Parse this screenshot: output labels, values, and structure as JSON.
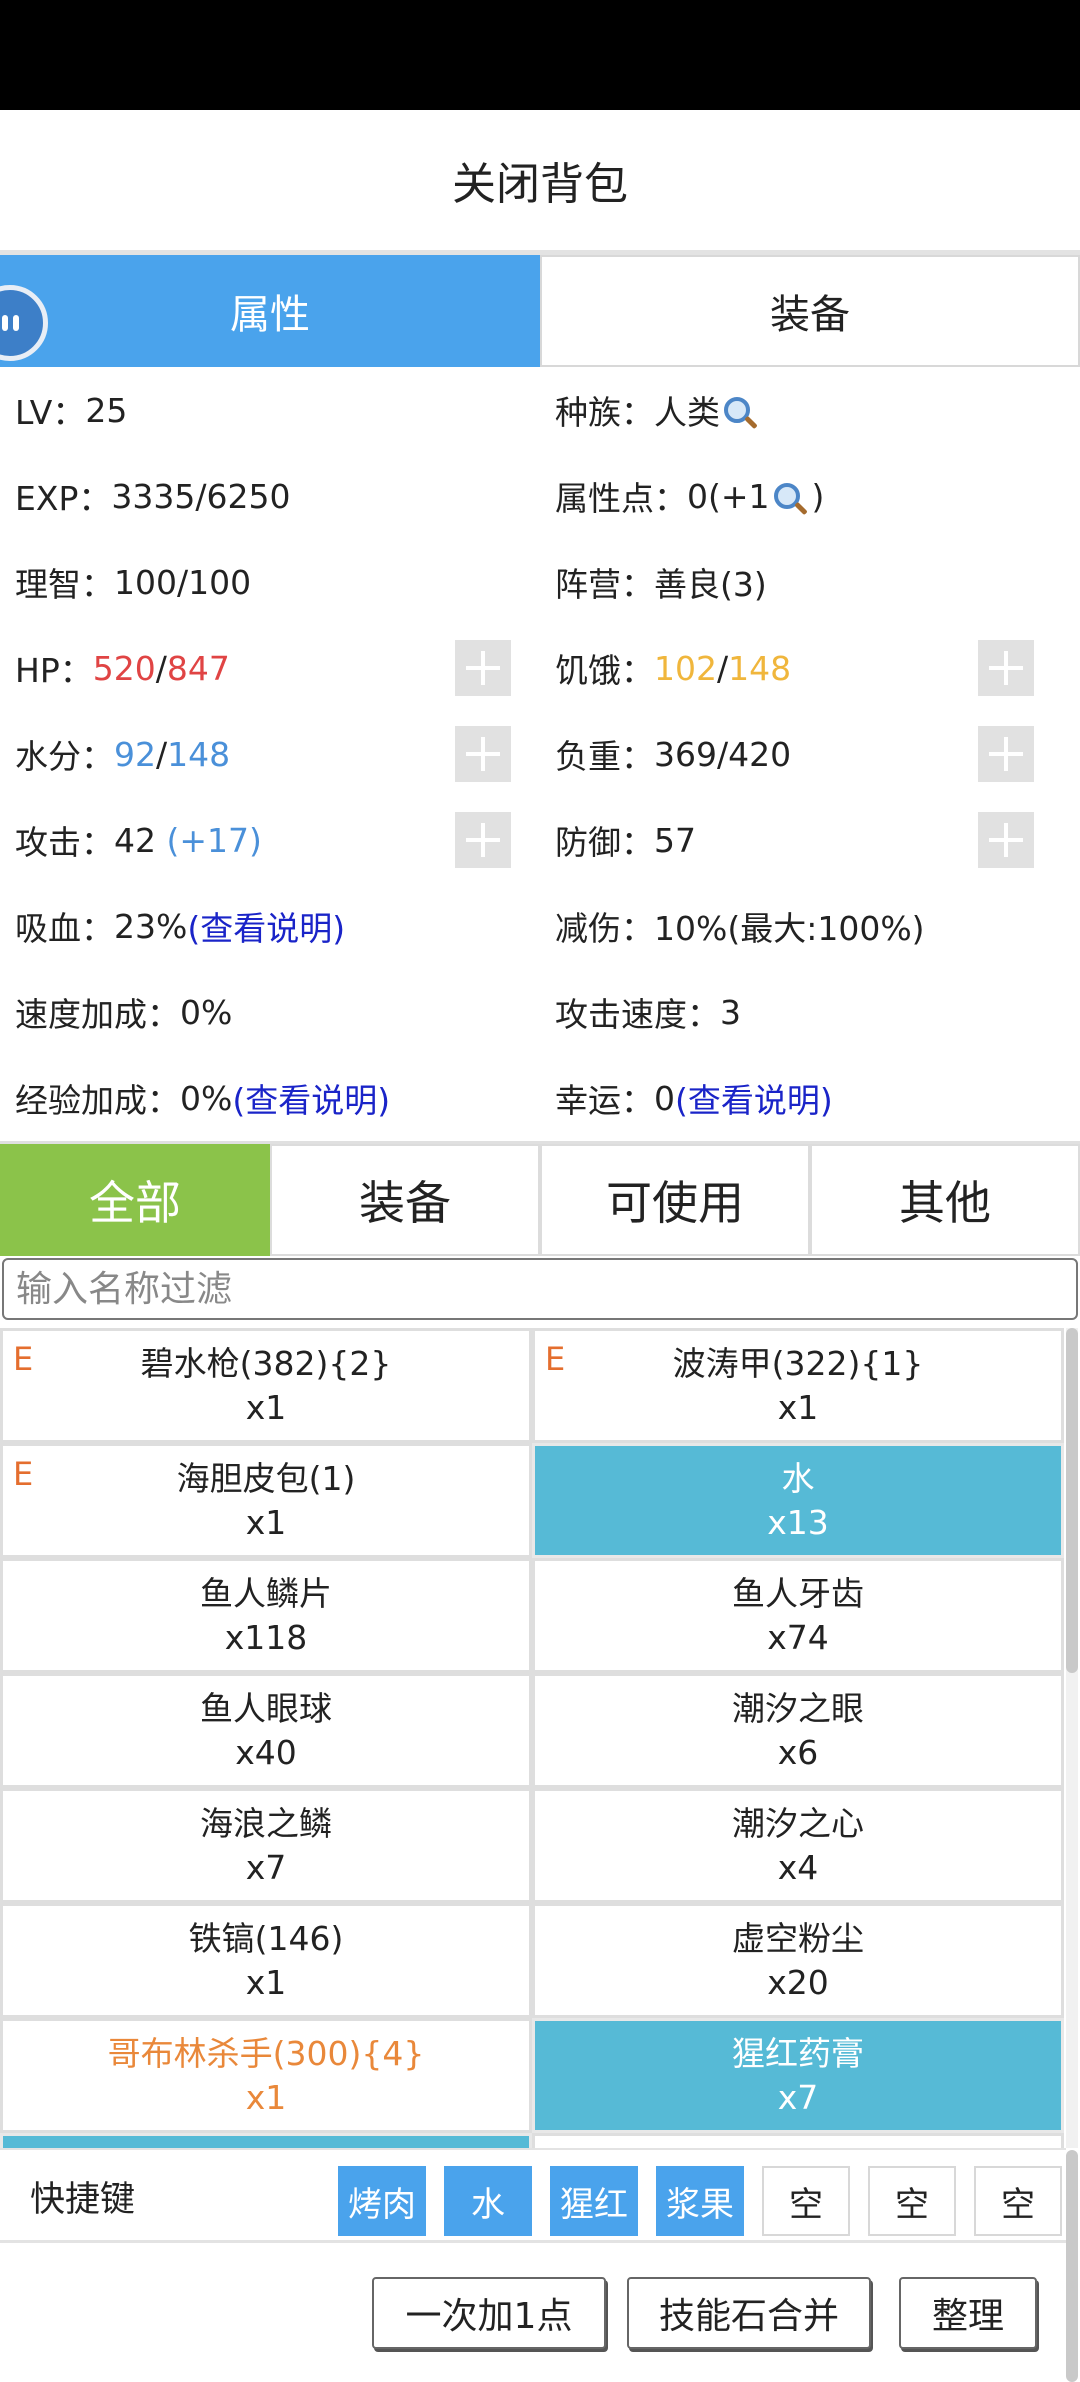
{
  "header": {
    "title": "关闭背包"
  },
  "top_tabs": [
    {
      "label": "属性",
      "active": true
    },
    {
      "label": "装备",
      "active": false
    }
  ],
  "stats": {
    "lv_label": "LV：",
    "lv_value": "25",
    "race_label": "种族：",
    "race_value": "人类",
    "exp_label": "EXP：",
    "exp_value": "3335/6250",
    "points_label": "属性点：",
    "points_value": "0(+1",
    "points_close": ")",
    "sanity_label": "理智：",
    "sanity_value": "100/100",
    "camp_label": "阵营：",
    "camp_value": "善良(3)",
    "hp_label": "HP：",
    "hp_current": "520",
    "hp_sep": "/",
    "hp_max": "847",
    "hunger_label": "饥饿：",
    "hunger_current": "102",
    "hunger_sep": "/",
    "hunger_max": "148",
    "water_label": "水分：",
    "water_current": "92",
    "water_sep": "/",
    "water_max": "148",
    "load_label": "负重：",
    "load_value": "369/420",
    "attack_label": "攻击：",
    "attack_value": "42 ",
    "attack_bonus": "(+17)",
    "defense_label": "防御：",
    "defense_value": "57",
    "lifesteal_label": "吸血：",
    "lifesteal_value": "23%",
    "lifesteal_link": "(查看说明)",
    "dmgreduce_label": "减伤：",
    "dmgreduce_value": "10%(最大:100%)",
    "speed_label": "速度加成：",
    "speed_value": "0%",
    "atkspeed_label": "攻击速度：",
    "atkspeed_value": "3",
    "expbonus_label": "经验加成：",
    "expbonus_value": "0%",
    "expbonus_link": "(查看说明)",
    "luck_label": "幸运：",
    "luck_value": "0",
    "luck_link": "(查看说明)"
  },
  "category_tabs": [
    {
      "label": "全部",
      "active": true
    },
    {
      "label": "装备",
      "active": false
    },
    {
      "label": "可使用",
      "active": false
    },
    {
      "label": "其他",
      "active": false
    }
  ],
  "filter": {
    "placeholder": "输入名称过滤"
  },
  "items": [
    {
      "mark": "E",
      "name": "碧水枪(382){2}",
      "qty": "x1",
      "style": "normal"
    },
    {
      "mark": "E",
      "name": "波涛甲(322){1}",
      "qty": "x1",
      "style": "normal"
    },
    {
      "mark": "E",
      "name": "海胆皮包(1)",
      "qty": "x1",
      "style": "normal"
    },
    {
      "mark": "",
      "name": "水",
      "qty": "x13",
      "style": "teal"
    },
    {
      "mark": "",
      "name": "鱼人鳞片",
      "qty": "x118",
      "style": "normal"
    },
    {
      "mark": "",
      "name": "鱼人牙齿",
      "qty": "x74",
      "style": "normal"
    },
    {
      "mark": "",
      "name": "鱼人眼球",
      "qty": "x40",
      "style": "normal"
    },
    {
      "mark": "",
      "name": "潮汐之眼",
      "qty": "x6",
      "style": "normal"
    },
    {
      "mark": "",
      "name": "海浪之鳞",
      "qty": "x7",
      "style": "normal"
    },
    {
      "mark": "",
      "name": "潮汐之心",
      "qty": "x4",
      "style": "normal"
    },
    {
      "mark": "",
      "name": "铁镐(146)",
      "qty": "x1",
      "style": "normal"
    },
    {
      "mark": "",
      "name": "虚空粉尘",
      "qty": "x20",
      "style": "normal"
    },
    {
      "mark": "",
      "name": "哥布林杀手(300){4}",
      "qty": "x1",
      "style": "orange"
    },
    {
      "mark": "",
      "name": "猩红药膏",
      "qty": "x7",
      "style": "teal"
    },
    {
      "mark": "",
      "name": "",
      "qty": "",
      "style": "teal"
    },
    {
      "mark": "",
      "name": "",
      "qty": "",
      "style": "normal"
    }
  ],
  "hotkeys": {
    "label": "快捷键",
    "slots": [
      {
        "label": "烤肉",
        "filled": true
      },
      {
        "label": "水",
        "filled": true
      },
      {
        "label": "猩红",
        "filled": true
      },
      {
        "label": "浆果",
        "filled": true
      },
      {
        "label": "空",
        "filled": false
      },
      {
        "label": "空",
        "filled": false
      },
      {
        "label": "空",
        "filled": false
      }
    ]
  },
  "actions": {
    "add_one": "一次加1点",
    "merge_stones": "技能石合并",
    "sort": "整理"
  },
  "colors": {
    "tab_active_blue": "#4aa3ec",
    "category_active_green": "#8bc34a",
    "teal_item": "#56bad6",
    "hp_red": "#e04444",
    "hunger_yellow": "#f0b63c",
    "water_blue": "#4a90d9",
    "link_blue": "#1a24c8",
    "equip_mark_orange": "#e46e2e"
  }
}
